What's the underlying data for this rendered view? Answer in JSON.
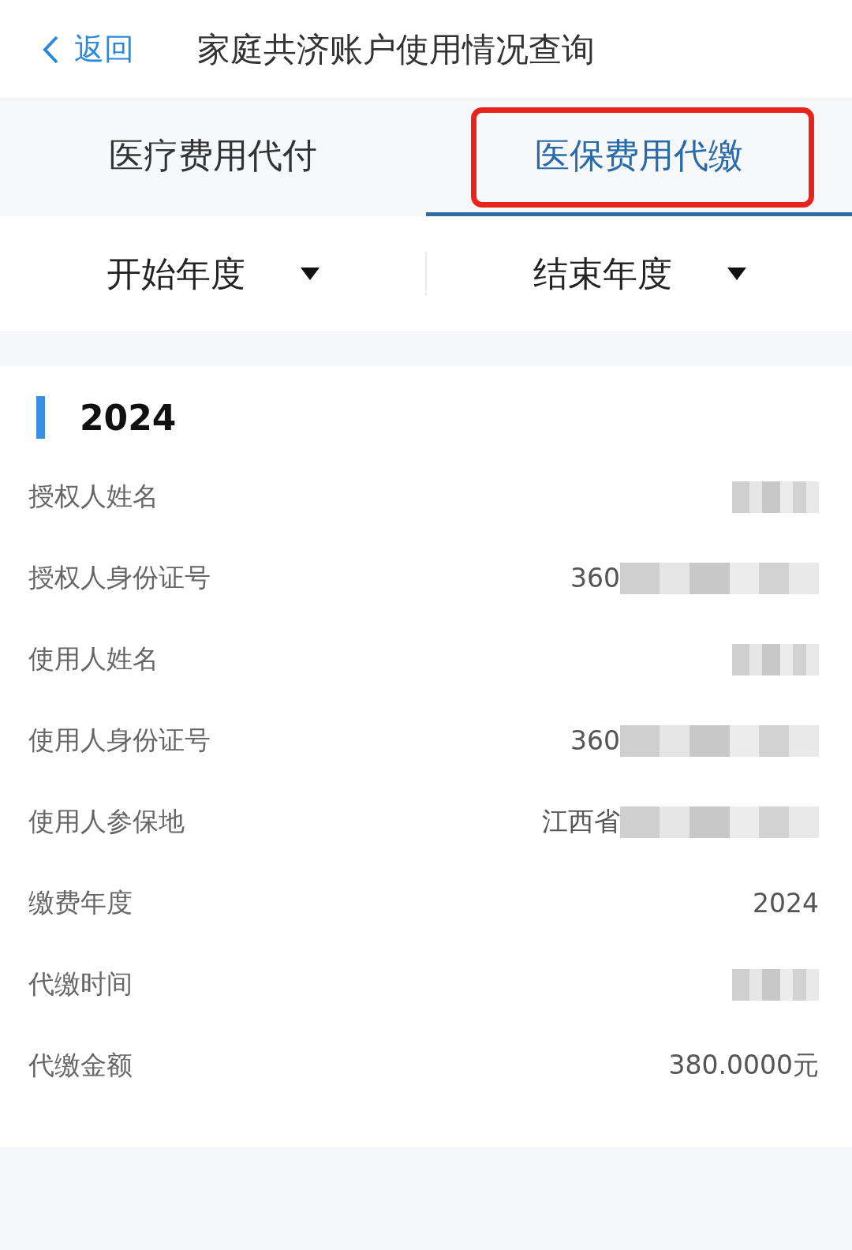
{
  "header": {
    "back": "返回",
    "title": "家庭共济账户使用情况查询"
  },
  "tabs": [
    {
      "label": "医疗费用代付",
      "selected": false,
      "highlighted": false
    },
    {
      "label": "医保费用代缴",
      "selected": true,
      "highlighted": true
    }
  ],
  "filters": [
    {
      "label": "开始年度"
    },
    {
      "label": "结束年度"
    }
  ],
  "record": {
    "year": "2024",
    "rows": [
      {
        "label": "授权人姓名",
        "kind": "redacted"
      },
      {
        "label": "授权人身份证号",
        "value": "360",
        "kind": "partly_redacted"
      },
      {
        "label": "使用人姓名",
        "kind": "redacted"
      },
      {
        "label": "使用人身份证号",
        "value": "360",
        "kind": "partly_redacted"
      },
      {
        "label": "使用人参保地",
        "value": "江西省",
        "kind": "partly_redacted"
      },
      {
        "label": "缴费年度",
        "value": "2024",
        "kind": "text"
      },
      {
        "label": "代缴时间",
        "kind": "redacted"
      },
      {
        "label": "代缴金额",
        "value": "380.0000元",
        "kind": "text"
      }
    ]
  }
}
